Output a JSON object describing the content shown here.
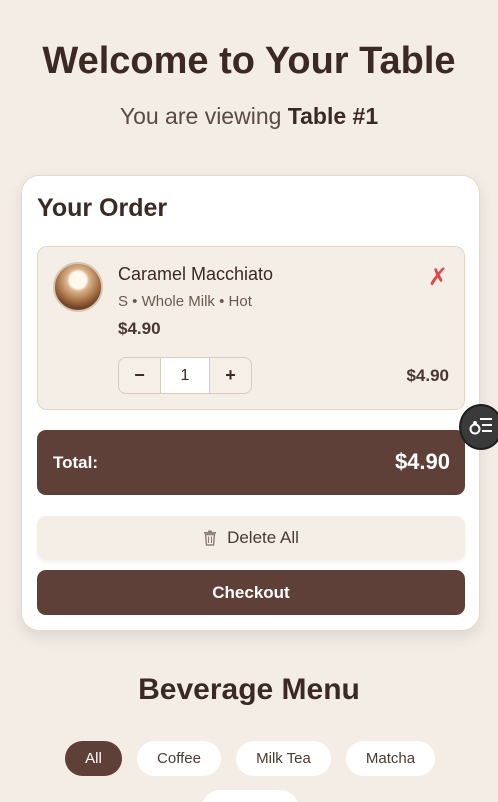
{
  "hero": {
    "title": "Welcome to Your Table",
    "subtitle_prefix": "You are viewing ",
    "table_label": "Table #1"
  },
  "order": {
    "title": "Your Order",
    "items": [
      {
        "name": "Caramel Macchiato",
        "options": "S • Whole Milk • Hot",
        "price": "$4.90",
        "quantity": "1",
        "line_total": "$4.90",
        "remove_symbol": "✗",
        "minus_symbol": "−",
        "plus_symbol": "+"
      }
    ],
    "total_label": "Total:",
    "total_value": "$4.90",
    "delete_all_label": "Delete All",
    "checkout_label": "Checkout"
  },
  "menu": {
    "title": "Beverage Menu",
    "filters": [
      {
        "label": "All",
        "active": true
      },
      {
        "label": "Coffee",
        "active": false
      },
      {
        "label": "Milk Tea",
        "active": false
      },
      {
        "label": "Matcha",
        "active": false
      }
    ]
  },
  "icons": {
    "trash": "trash-icon",
    "accessibility": "accessibility-menu-icon"
  },
  "colors": {
    "background": "#f3ede5",
    "accent": "#5f4038",
    "danger": "#e04848"
  }
}
